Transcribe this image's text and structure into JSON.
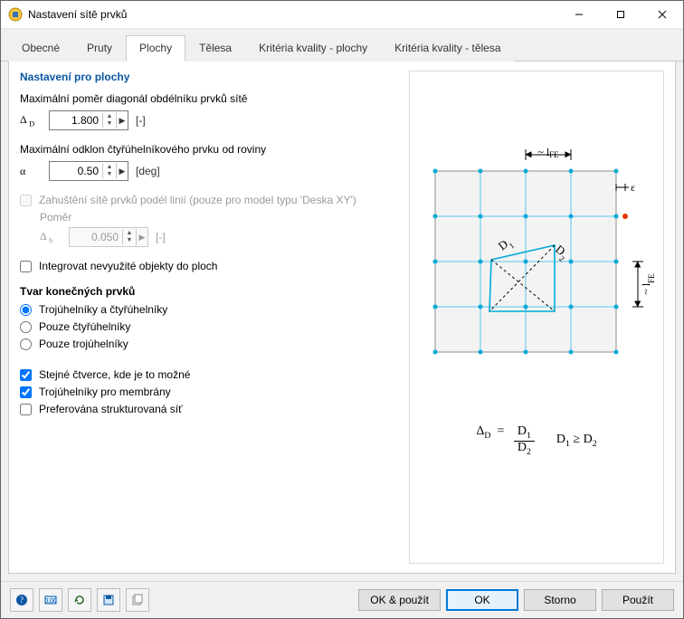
{
  "window": {
    "title": "Nastavení sítě prvků"
  },
  "tabs": {
    "items": [
      {
        "label": "Obecné"
      },
      {
        "label": "Pruty"
      },
      {
        "label": "Plochy"
      },
      {
        "label": "Tělesa"
      },
      {
        "label": "Kritéria kvality - plochy"
      },
      {
        "label": "Kritéria kvality - tělesa"
      }
    ],
    "active_index": 2
  },
  "section": {
    "title": "Nastavení pro plochy"
  },
  "ratio": {
    "label": "Maximální poměr diagonál obdélníku prvků sítě",
    "symbol": "Δ D",
    "value": "1.800",
    "unit": "[-]"
  },
  "incl": {
    "label": "Maximální odklon čtyřúhelníkového prvku od roviny",
    "symbol": "α",
    "value": "0.50",
    "unit": "[deg]"
  },
  "refine": {
    "label": "Zahuštění sítě prvků podél linií (pouze pro model typu 'Deska XY')",
    "ratio_label": "Poměr",
    "symbol": "Δ b",
    "value": "0.050",
    "unit": "[-]"
  },
  "integrate": {
    "label": "Integrovat nevyužité objekty do ploch"
  },
  "shape": {
    "title": "Tvar konečných prvků",
    "opt1": "Trojúhelníky a čtyřúhelníky",
    "opt2": "Pouze čtyřúhelníky",
    "opt3": "Pouze trojúhelníky"
  },
  "extras": {
    "same_squares": "Stejné čtverce, kde je to možné",
    "tri_membranes": "Trojúhelníky pro membrány",
    "pref_struct": "Preferována strukturovaná síť"
  },
  "diagram": {
    "lfe_top": "~ lFE",
    "lfe_right": "~ lFE",
    "eps": "ε",
    "d1": "D1",
    "d2": "D2"
  },
  "formula": {
    "lhs": "ΔD",
    "eq": "=",
    "num": "D1",
    "den": "D2",
    "cond": "D1 ≥ D2"
  },
  "footer": {
    "ok_apply": "OK & použít",
    "ok": "OK",
    "cancel": "Storno",
    "apply": "Použít"
  }
}
